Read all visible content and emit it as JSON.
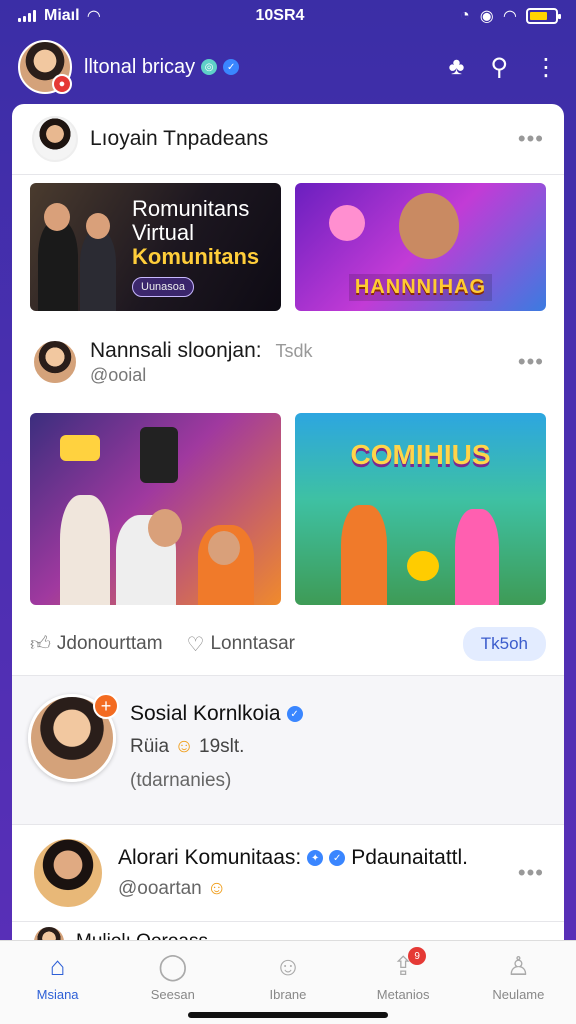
{
  "status_bar": {
    "carrier": "Miaıl",
    "time": "10SR4"
  },
  "header": {
    "title": "lltonal bricay"
  },
  "posts": [
    {
      "author": "Lıoyain Tnpadeans",
      "more": "•••",
      "images": [
        {
          "title_line1": "Romunitans",
          "title_line2": "Virtual",
          "title_line3": "Komunitans",
          "pill": "Uunasoa"
        },
        {
          "banner": "HANNNIHAG"
        }
      ]
    },
    {
      "author": "Nannsali sloonjan:",
      "meta": "Tsdk",
      "handle": "@ooial",
      "more": "•••",
      "images": [
        {
          "label": ""
        },
        {
          "banner": "COMIHIUS"
        }
      ],
      "actions": {
        "like": "Jdonourttam",
        "comment": "Lonntasar",
        "chip": "Tk5oh"
      }
    },
    {
      "author": "Sosial Kornlkoia",
      "line": "Rüia",
      "line_meta": "19slt.",
      "sub": "(tdarnanies)"
    },
    {
      "author": "Alorari Komunitaas:",
      "author_suffix": "Pdaunaitattl.",
      "handle": "@ooartan",
      "more": "•••"
    },
    {
      "author": "Muliolı Qoroass"
    }
  ],
  "tabbar": [
    {
      "label": "Msiana",
      "icon": "home-icon",
      "active": true
    },
    {
      "label": "Seesan",
      "icon": "chat-icon",
      "active": false
    },
    {
      "label": "Ibrane",
      "icon": "profile-icon",
      "active": false
    },
    {
      "label": "Metanios",
      "icon": "upload-icon",
      "active": false,
      "badge": "9"
    },
    {
      "label": "Neulame",
      "icon": "user-icon",
      "active": false
    }
  ],
  "colors": {
    "accent": "#2d5fd6",
    "header_bg": "#3b2ea6",
    "badge": "#e53935"
  }
}
